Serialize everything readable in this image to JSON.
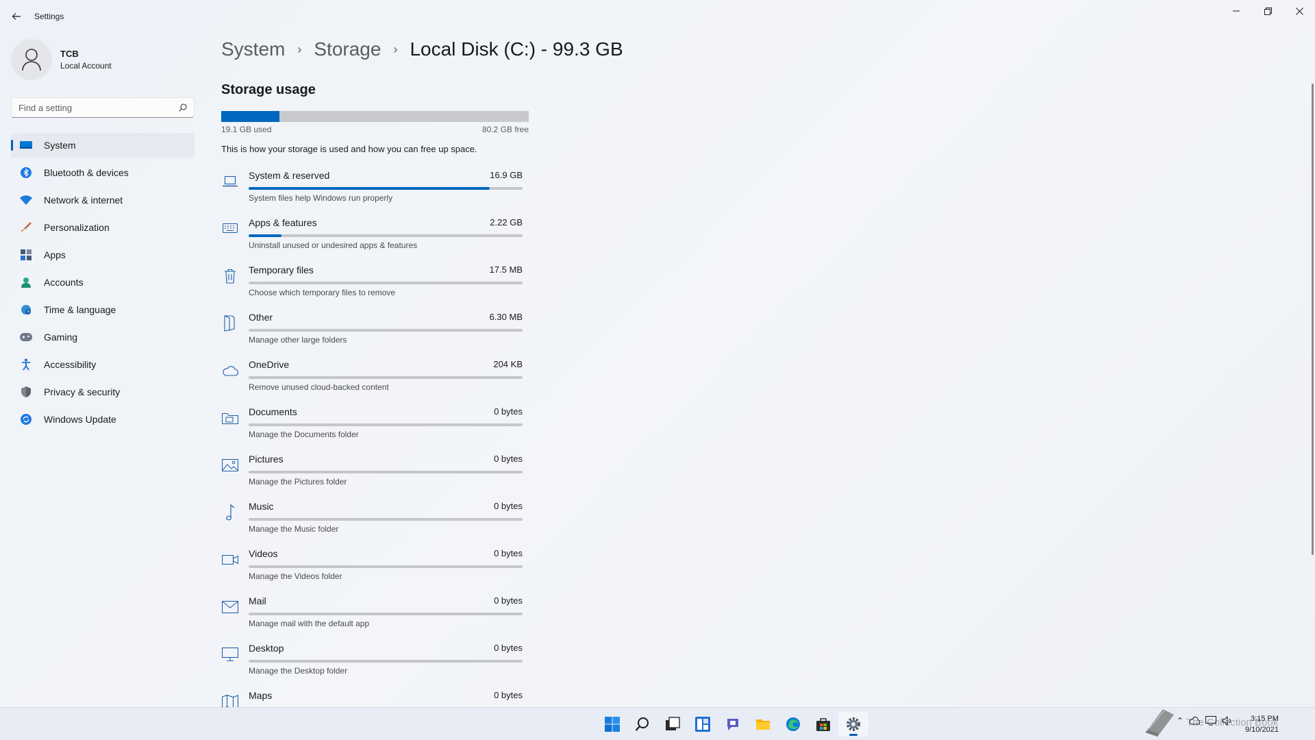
{
  "window": {
    "title": "Settings"
  },
  "profile": {
    "name": "TCB",
    "account_type": "Local Account"
  },
  "search": {
    "placeholder": "Find a setting"
  },
  "sidebar": {
    "items": [
      {
        "label": "System",
        "icon": "monitor-icon",
        "active": true
      },
      {
        "label": "Bluetooth & devices",
        "icon": "bluetooth-icon"
      },
      {
        "label": "Network & internet",
        "icon": "wifi-icon"
      },
      {
        "label": "Personalization",
        "icon": "brush-icon"
      },
      {
        "label": "Apps",
        "icon": "apps-icon"
      },
      {
        "label": "Accounts",
        "icon": "person-icon"
      },
      {
        "label": "Time & language",
        "icon": "globe-clock-icon"
      },
      {
        "label": "Gaming",
        "icon": "gamepad-icon"
      },
      {
        "label": "Accessibility",
        "icon": "accessibility-icon"
      },
      {
        "label": "Privacy & security",
        "icon": "shield-icon"
      },
      {
        "label": "Windows Update",
        "icon": "update-icon"
      }
    ]
  },
  "breadcrumb": {
    "system": "System",
    "storage": "Storage",
    "current": "Local Disk (C:) - 99.3 GB"
  },
  "storage": {
    "section_title": "Storage usage",
    "used_label": "19.1 GB used",
    "free_label": "80.2 GB free",
    "used_fraction": 0.19,
    "description": "This is how your storage is used and how you can free up space.",
    "categories": [
      {
        "name": "System & reserved",
        "size": "16.9 GB",
        "desc": "System files help Windows run properly",
        "fraction": 0.88,
        "icon": "laptop-icon"
      },
      {
        "name": "Apps & features",
        "size": "2.22 GB",
        "desc": "Uninstall unused or undesired apps & features",
        "fraction": 0.12,
        "icon": "keyboard-icon"
      },
      {
        "name": "Temporary files",
        "size": "17.5 MB",
        "desc": "Choose which temporary files to remove",
        "fraction": 0,
        "icon": "trash-icon"
      },
      {
        "name": "Other",
        "size": "6.30 MB",
        "desc": "Manage other large folders",
        "fraction": 0,
        "icon": "folder-open-icon"
      },
      {
        "name": "OneDrive",
        "size": "204 KB",
        "desc": "Remove unused cloud-backed content",
        "fraction": 0,
        "icon": "cloud-icon"
      },
      {
        "name": "Documents",
        "size": "0 bytes",
        "desc": "Manage the Documents folder",
        "fraction": 0,
        "icon": "documents-icon"
      },
      {
        "name": "Pictures",
        "size": "0 bytes",
        "desc": "Manage the Pictures folder",
        "fraction": 0,
        "icon": "image-icon"
      },
      {
        "name": "Music",
        "size": "0 bytes",
        "desc": "Manage the Music folder",
        "fraction": 0,
        "icon": "music-note-icon"
      },
      {
        "name": "Videos",
        "size": "0 bytes",
        "desc": "Manage the Videos folder",
        "fraction": 0,
        "icon": "video-camera-icon"
      },
      {
        "name": "Mail",
        "size": "0 bytes",
        "desc": "Manage mail with the default app",
        "fraction": 0,
        "icon": "mail-icon"
      },
      {
        "name": "Desktop",
        "size": "0 bytes",
        "desc": "Manage the Desktop folder",
        "fraction": 0,
        "icon": "desktop-icon"
      },
      {
        "name": "Maps",
        "size": "0 bytes",
        "desc": "",
        "fraction": 0,
        "icon": "map-icon"
      }
    ]
  },
  "taskbar": {
    "apps": [
      "start-icon",
      "search-icon",
      "task-view-icon",
      "widgets-icon",
      "chat-icon",
      "file-explorer-icon",
      "edge-icon",
      "store-icon",
      "settings-icon"
    ],
    "active_app": "settings-icon",
    "time": "3:15 PM",
    "date": "9/10/2021",
    "watermark": "The Collection Book"
  },
  "colors": {
    "accent": "#0067c0",
    "bar_track": "#c5c6c9"
  }
}
